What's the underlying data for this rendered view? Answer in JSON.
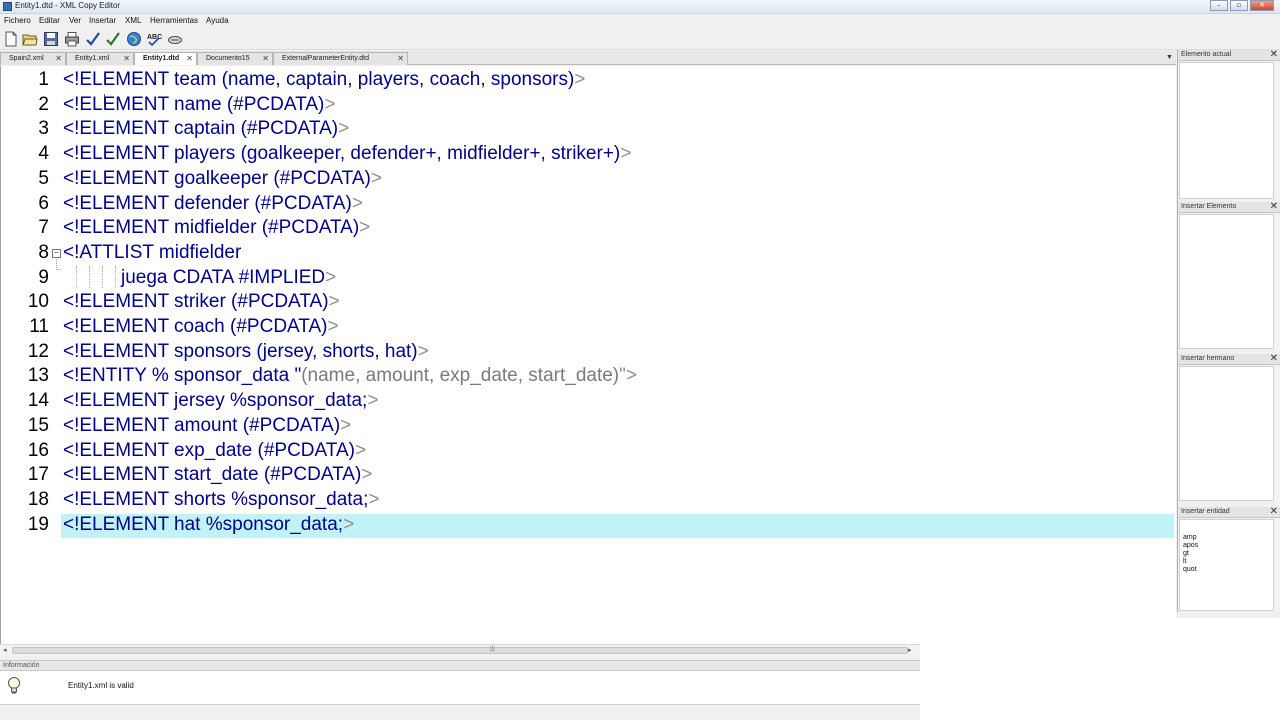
{
  "window": {
    "title": "Entity1.dtd - XML Copy Editor"
  },
  "menu": [
    "Fichero",
    "Editar",
    "Ver",
    "Insertar",
    "XML",
    "Herramientas",
    "Ayuda"
  ],
  "toolbar": {
    "icons": [
      "new-file-icon",
      "open-folder-icon",
      "save-icon",
      "print-icon",
      "check-wellformed-icon",
      "validate-icon",
      "browser-icon",
      "spellcheck-icon",
      "xpath-icon"
    ]
  },
  "tabs": [
    {
      "label": "Spain2.xml",
      "active": false
    },
    {
      "label": "Entity1.xml",
      "active": false
    },
    {
      "label": "Entity1.dtd",
      "active": true
    },
    {
      "label": "Documento15",
      "active": false
    },
    {
      "label": "ExternalParameterEntity.dtd",
      "active": false
    }
  ],
  "editor": {
    "current_line": 19,
    "lines": [
      {
        "n": "1",
        "tag": "<!ELEMENT team (name, captain, players, coach, sponsors)",
        "str": "",
        "end": ">"
      },
      {
        "n": "2",
        "tag": "<!ELEMENT name (#PCDATA)",
        "str": "",
        "end": ">"
      },
      {
        "n": "3",
        "tag": "<!ELEMENT captain (#PCDATA)",
        "str": "",
        "end": ">"
      },
      {
        "n": "4",
        "tag": "<!ELEMENT players (goalkeeper, defender+, midfielder+, striker+)",
        "str": "",
        "end": ">"
      },
      {
        "n": "5",
        "tag": "<!ELEMENT goalkeeper (#PCDATA)",
        "str": "",
        "end": ">"
      },
      {
        "n": "6",
        "tag": "<!ELEMENT defender (#PCDATA)",
        "str": "",
        "end": ">"
      },
      {
        "n": "7",
        "tag": "<!ELEMENT midfielder (#PCDATA)",
        "str": "",
        "end": ">"
      },
      {
        "n": "8",
        "tag": "<!ATTLIST midfielder",
        "str": "",
        "end": ""
      },
      {
        "n": "9",
        "tag": "juega CDATA #IMPLIED",
        "str": "",
        "end": ">"
      },
      {
        "n": "10",
        "tag": "<!ELEMENT striker (#PCDATA)",
        "str": "",
        "end": ">"
      },
      {
        "n": "11",
        "tag": "<!ELEMENT coach (#PCDATA)",
        "str": "",
        "end": ">"
      },
      {
        "n": "12",
        "tag": "<!ELEMENT sponsors (jersey, shorts, hat)",
        "str": "",
        "end": ">"
      },
      {
        "n": "13",
        "tag": "<!ENTITY % sponsor_data \"",
        "str": "(name, amount, exp_date, start_date)",
        "end": "\">"
      },
      {
        "n": "14",
        "tag": "<!ELEMENT jersey %sponsor_data;",
        "str": "",
        "end": ">"
      },
      {
        "n": "15",
        "tag": "<!ELEMENT amount (#PCDATA)",
        "str": "",
        "end": ">"
      },
      {
        "n": "16",
        "tag": "<!ELEMENT exp_date (#PCDATA)",
        "str": "",
        "end": ">"
      },
      {
        "n": "17",
        "tag": "<!ELEMENT start_date (#PCDATA)",
        "str": "",
        "end": ">"
      },
      {
        "n": "18",
        "tag": "<!ELEMENT shorts %sponsor_data;",
        "str": "",
        "end": ">"
      },
      {
        "n": "19",
        "tag": "<!ELEMENT hat %sponsor_data;",
        "str": "",
        "end": ">"
      }
    ]
  },
  "info": {
    "header": "Información",
    "message": "Entity1.xml is valid"
  },
  "sidebar": {
    "panels": [
      {
        "title": "Elemento actual"
      },
      {
        "title": "Insertar Elemento"
      },
      {
        "title": "Insertar hermano"
      },
      {
        "title": "Insertar entidad"
      }
    ],
    "entities": [
      "amp",
      "apos",
      "gt",
      "lt",
      "quot"
    ]
  },
  "colors": {
    "tag": "#00008b",
    "bracket": "#909090",
    "string": "#7a7a7a",
    "current_line_bg": "#bff3f5"
  }
}
